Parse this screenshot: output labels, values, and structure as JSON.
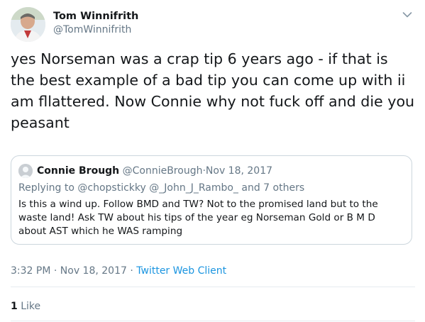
{
  "author": {
    "display_name": "Tom Winnifrith",
    "handle": "@TomWinnifrith"
  },
  "tweet": {
    "text": "yes Norseman was a crap tip 6 years ago - if that is the best example of a bad tip you can come up with ii am fllattered. Now Connie why not fuck off and die you peasant"
  },
  "quoted_tweet": {
    "display_name": "Connie Brough",
    "handle": "@ConnieBrough",
    "separator": "·",
    "date": "Nov 18, 2017",
    "reply_prefix": "Replying to",
    "reply_to": [
      "@chopstickky",
      "@_John_J_Rambo_"
    ],
    "reply_and": "and",
    "reply_others": "7 others",
    "text": "Is this a wind up. Follow BMD  and TW?  Not to the promised land but to the waste land!  Ask TW about his tips of the year eg Norseman Gold or B M D about AST which he WAS ramping"
  },
  "meta": {
    "time": "3:32 PM",
    "separator": "·",
    "date": "Nov 18, 2017",
    "separator2": "·",
    "client": "Twitter Web Client"
  },
  "stats": {
    "like_count": "1",
    "like_label": "Like"
  },
  "icons": {
    "menu": "chevron-down-icon",
    "avatar": "avatar",
    "quote_avatar": "avatar"
  },
  "colors": {
    "link": "#1b95e0",
    "secondary_text": "#657786",
    "border": "#ccd6dd"
  }
}
